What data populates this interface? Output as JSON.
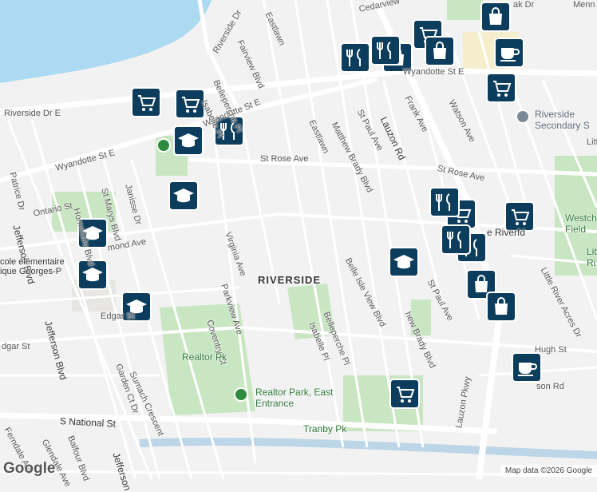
{
  "map": {
    "district": "RIVERSIDE",
    "street_labels": [
      "Riverside Dr E",
      "Wyandotte St E",
      "Wyandotte St E",
      "Wyandotte St E",
      "St Rose Ave",
      "St Rose Ave",
      "Ontario St",
      "mond Ave",
      "Edgar St",
      "dgar St",
      "Hugh St",
      "S National St",
      "Cedarview",
      "Riverside Dr",
      "Eastlawn",
      "Eastlawn",
      "Fairview Blvd",
      "Belleperche Pl",
      "Isabelle Pl",
      "Virginia Ave",
      "Parkview Ave",
      "Coventry Ct",
      "Matthew Brady Blvd",
      "St Paul Ave",
      "Lauzon Rd",
      "Frank Ave",
      "Watson Ave",
      "Belle Isle View Blvd",
      "Belleperche Pl",
      "Isabelle Pl",
      "hew Brady Blvd",
      "St Paul Ave",
      "Little River Acres Dr",
      "Lauzon Pkwy",
      "son Rd",
      "Patrice Dr",
      "Jefferson Blvd",
      "Jefferson Blvd",
      "Jefferson",
      "Homedale Blvd",
      "St Marys Blvd",
      "Janisse Dr",
      "Sumach Crescent",
      "Garden Ct Dr",
      "Ferndale Ave",
      "Glendale Ave",
      "Balfour Blvd",
      "ak Dr",
      "Menn",
      "Litt"
    ],
    "poi_labels": [
      "Realtor Pk",
      "Realtor Park, East Entrance",
      "Tranby Pk",
      "Riverside Secondary S",
      "cole élémentaire ique Georges-P",
      "Westche Field",
      "Littl Ri",
      "e Riverfd"
    ],
    "pins": [
      {
        "icon": "shopping-cart",
        "label": "Grocery"
      },
      {
        "icon": "shopping-bag",
        "label": "Shop"
      },
      {
        "icon": "restaurant",
        "label": "Restaurant"
      },
      {
        "icon": "school",
        "label": "School"
      },
      {
        "icon": "coffee",
        "label": "Cafe"
      }
    ],
    "colors": {
      "water": "#abdaf2",
      "park": "#c9e6c2",
      "road": "#ffffff",
      "pin": "#0d3d5c",
      "background": "#f2f2f2"
    }
  },
  "footer": {
    "logo": "Google",
    "attribution": "Map data ©2026 Google"
  }
}
